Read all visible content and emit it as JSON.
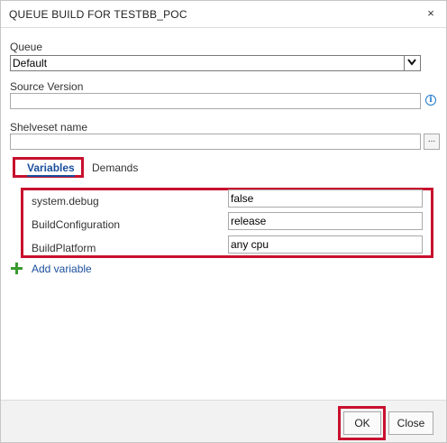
{
  "dialog": {
    "title": "QUEUE BUILD FOR TESTBB_POC",
    "close_glyph": "×"
  },
  "queue": {
    "label": "Queue",
    "selected": "Default"
  },
  "source_version": {
    "label": "Source Version",
    "value": "",
    "info_glyph": "i"
  },
  "shelveset": {
    "label": "Shelveset name",
    "value": "",
    "browse_label": "..."
  },
  "tabs": [
    {
      "label": "Variables",
      "active": true
    },
    {
      "label": "Demands",
      "active": false
    }
  ],
  "variables": [
    {
      "name": "system.debug",
      "value": "false"
    },
    {
      "name": "BuildConfiguration",
      "value": "release"
    },
    {
      "name": "BuildPlatform",
      "value": "any cpu"
    }
  ],
  "add_variable": {
    "label": "Add variable"
  },
  "footer": {
    "ok_label": "OK",
    "close_label": "Close"
  },
  "colors": {
    "highlight": "#c8102e",
    "link": "#1a4f9c",
    "add_icon": "#3a9a2e",
    "info_icon": "#1f7acb"
  },
  "icons": {
    "close": "close-icon",
    "dropdown": "chevron-down-icon",
    "info": "info-icon",
    "add": "plus-icon"
  }
}
